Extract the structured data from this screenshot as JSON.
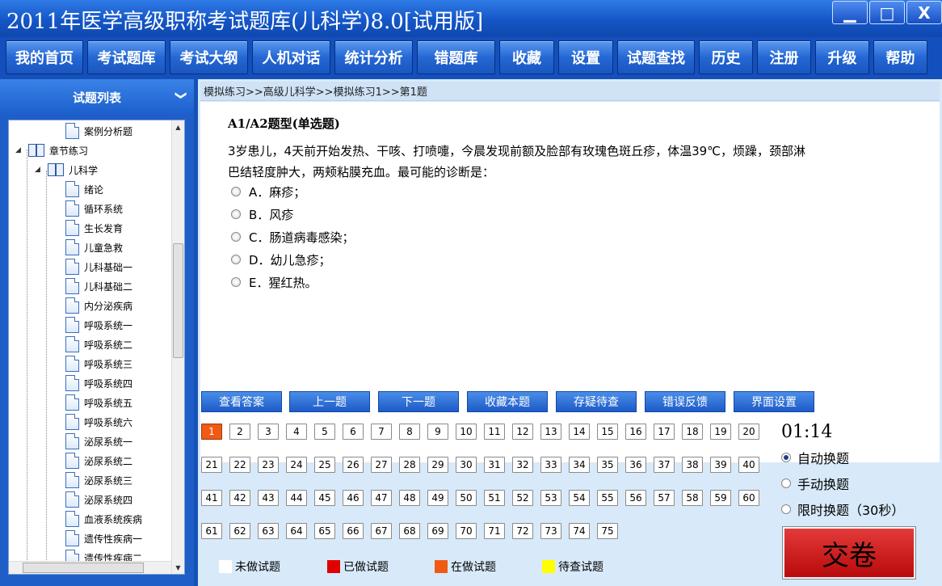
{
  "app": {
    "title": "2011年医学高级职称考试题库(儿科学)8.0[试用版]",
    "min_glyph": "▁",
    "max_glyph": "□",
    "close_glyph": "X"
  },
  "menu": [
    "我的首页",
    "考试题库",
    "考试大纲",
    "人机对话",
    "统计分析",
    "错题库",
    "收藏",
    "设置",
    "试题查找",
    "历史",
    "注册",
    "升级",
    "帮助"
  ],
  "sidebar": {
    "header": "试题列表",
    "collapse_glyph": "❯",
    "top_item": "案例分析题",
    "chapter": "章节练习",
    "subject": "儿科学",
    "items": [
      "绪论",
      "循环系统",
      "生长发育",
      "儿童急救",
      "儿科基础一",
      "儿科基础二",
      "内分泌疾病",
      "呼吸系统一",
      "呼吸系统二",
      "呼吸系统三",
      "呼吸系统四",
      "呼吸系统五",
      "呼吸系统六",
      "泌尿系统一",
      "泌尿系统二",
      "泌尿系统三",
      "泌尿系统四",
      "血液系统疾病",
      "遗传性疾病一",
      "遗传性疾病二"
    ]
  },
  "breadcrumb": "模拟练习>>高级儿科学>>模拟练习1>>第1题",
  "question": {
    "type": "A1/A2题型(单选题)",
    "line1": "3岁患儿，4天前开始发热、干咳、打喷嚏，今晨发现前额及脸部有玫瑰色斑丘疹，体温39℃，烦躁，颈部淋",
    "line2": "巴结轻度肿大，两颊粘膜充血。最可能的诊断是：",
    "options": [
      "A．麻疹；",
      "B．风疹",
      "C．肠道病毒感染；",
      "D．幼儿急疹；",
      "E．猩红热。"
    ]
  },
  "actions": [
    "查看答案",
    "上一题",
    "下一题",
    "收藏本题",
    "存疑待查",
    "错误反馈",
    "界面设置"
  ],
  "question_numbers": {
    "count": 75,
    "current": 1
  },
  "timer": "01:14",
  "modes": [
    {
      "label": "自动换题",
      "selected": true
    },
    {
      "label": "手动换题",
      "selected": false
    },
    {
      "label": "限时换题（30秒）",
      "selected": false
    }
  ],
  "submit_label": "交卷",
  "legend": [
    {
      "label": "未做试题",
      "color": "#ffffff"
    },
    {
      "label": "已做试题",
      "color": "#e00000"
    },
    {
      "label": "在做试题",
      "color": "#f05a14"
    },
    {
      "label": "待查试题",
      "color": "#ffff00"
    }
  ]
}
